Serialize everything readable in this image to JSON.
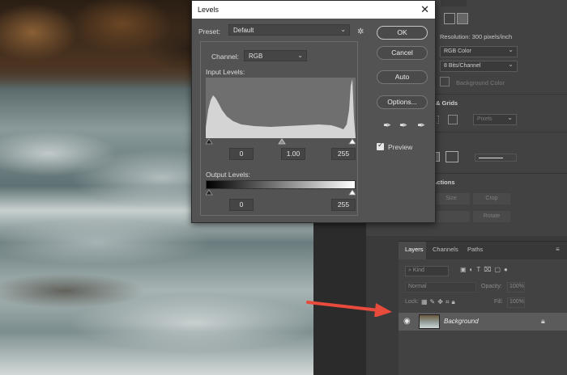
{
  "dialog": {
    "title": "Levels",
    "close": "✕",
    "preset_label": "Preset:",
    "preset_value": "Default",
    "channel_label": "Channel:",
    "channel_value": "RGB",
    "input_levels_label": "Input Levels:",
    "input_black": "0",
    "input_gamma": "1.00",
    "input_white": "255",
    "output_levels_label": "Output Levels:",
    "output_black": "0",
    "output_white": "255",
    "buttons": {
      "ok": "OK",
      "cancel": "Cancel",
      "auto": "Auto",
      "options": "Options..."
    },
    "preview_label": "Preview",
    "preview_checked": true
  },
  "properties": {
    "resolution": "Resolution: 300 pixels/inch",
    "mode": "RGB Color",
    "depth": "8 Bits/Channel",
    "background": "Background Color",
    "grids_section": "& Grids",
    "grid_unit": "Pixels",
    "actions_section": "Actions",
    "size_btn": "Size",
    "crop_btn": "Crop",
    "rotate_btn": "Rotate"
  },
  "layers_panel": {
    "tabs": [
      "Layers",
      "Channels",
      "Paths"
    ],
    "kind_placeholder": "Kind",
    "blend_mode": "Normal",
    "opacity_label": "Opacity:",
    "opacity_value": "100%",
    "lock_label": "Lock:",
    "fill_label": "Fill:",
    "fill_value": "100%",
    "layers": [
      {
        "name": "Background",
        "visible": true,
        "locked": true
      }
    ]
  },
  "colors": {
    "annotation_arrow": "#e84a3c",
    "dialog_bg": "#535353"
  }
}
